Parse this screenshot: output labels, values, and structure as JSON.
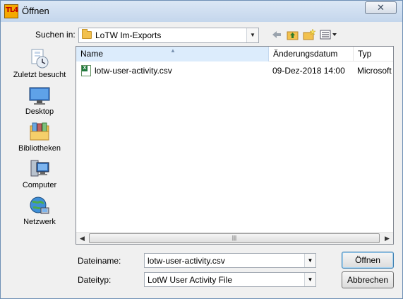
{
  "window": {
    "title": "Öffnen",
    "app_icon_text": "TL4",
    "close_symbol": "✕"
  },
  "toolbar": {
    "lookin_label": "Suchen in:",
    "lookin_value": "LoTW Im-Exports",
    "back_icon": "back-arrow-icon",
    "up_icon": "up-folder-icon",
    "new_folder_icon": "new-folder-icon",
    "views_icon": "view-menu-icon"
  },
  "places": [
    {
      "label": "Zuletzt besucht",
      "icon": "recent-places-icon"
    },
    {
      "label": "Desktop",
      "icon": "desktop-icon"
    },
    {
      "label": "Bibliotheken",
      "icon": "libraries-icon"
    },
    {
      "label": "Computer",
      "icon": "computer-icon"
    },
    {
      "label": "Netzwerk",
      "icon": "network-icon"
    }
  ],
  "filelist": {
    "columns": [
      "Name",
      "Änderungsdatum",
      "Typ"
    ],
    "sorted_column": "Name",
    "rows": [
      {
        "name": "lotw-user-activity.csv",
        "date": "09-Dez-2018 14:00",
        "type": "Microsoft",
        "icon": "excel-csv-icon"
      }
    ]
  },
  "filename": {
    "label": "Dateiname:",
    "value": "lotw-user-activity.csv"
  },
  "filetype": {
    "label": "Dateityp:",
    "value": "LotW User Activity File"
  },
  "buttons": {
    "open": "Öffnen",
    "cancel": "Abbrechen"
  },
  "colors": {
    "header_selected": "#dcecfc",
    "title_gradient_top": "#dbe7f5",
    "dialog_bg": "#f0f0f0"
  }
}
